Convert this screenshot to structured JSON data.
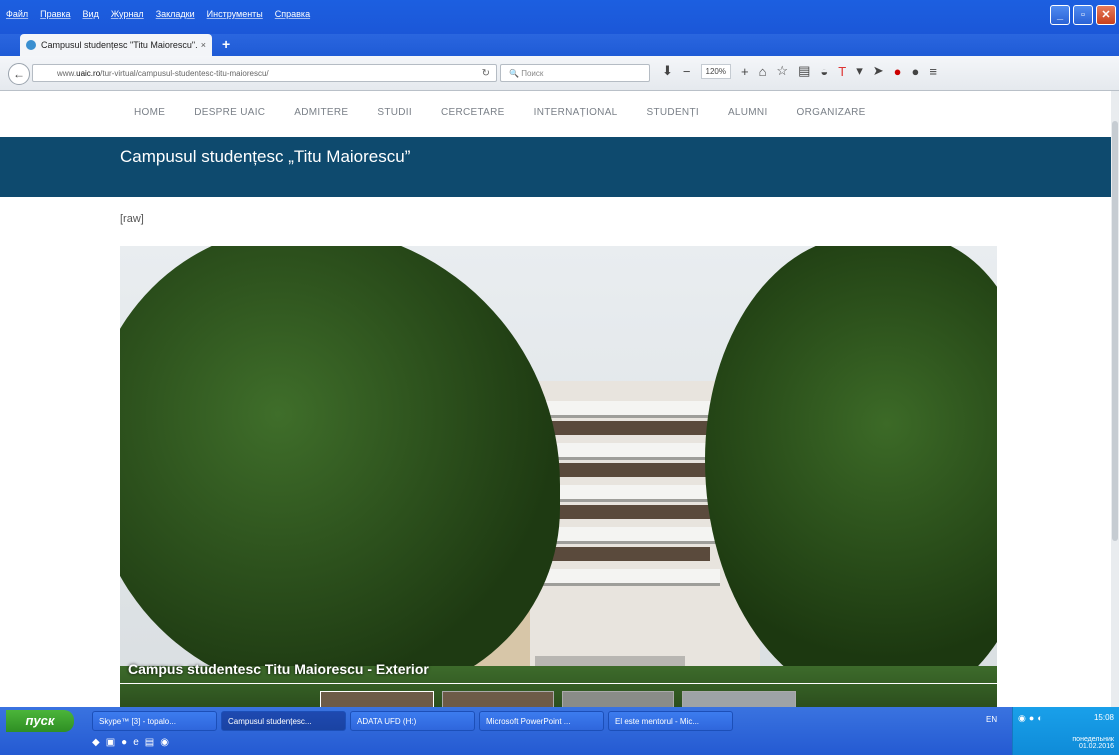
{
  "menubar": {
    "items": [
      "Файл",
      "Правка",
      "Вид",
      "Журнал",
      "Закладки",
      "Инструменты",
      "Справка"
    ]
  },
  "tab": {
    "title": "Campusul studențesc \"Titu Maiorescu\"...",
    "close": "×",
    "new": "+"
  },
  "nav": {
    "url_prefix": "www.",
    "url_host": "uaic.ro",
    "url_path": "/tur-virtual/campusul-studentesc-titu-maiorescu/",
    "search_placeholder": "Поиск",
    "zoom": "120%"
  },
  "site": {
    "menu": [
      "HOME",
      "DESPRE UAIC",
      "ADMITERE",
      "STUDII",
      "CERCETARE",
      "INTERNAȚIONAL",
      "STUDENȚI",
      "ALUMNI",
      "ORGANIZARE"
    ],
    "title": "Campusul studențesc „Titu Maiorescu”",
    "raw": "[raw]",
    "caption": "Campus studentesc Titu Maiorescu - Exterior"
  },
  "taskbar": {
    "start": "пуск",
    "tasks": [
      "Skype™ [3] - topalo...",
      "Campusul studențesc...",
      "ADATA UFD (H:)",
      "Microsoft PowerPoint ...",
      "El este mentorul - Mic..."
    ],
    "lang": "EN",
    "time": "15:08",
    "day": "понедельник",
    "date": "01.02.2016"
  }
}
